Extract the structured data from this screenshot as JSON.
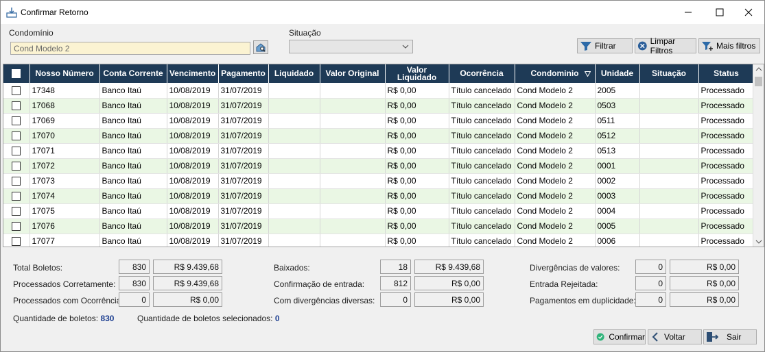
{
  "window": {
    "title": "Confirmar Retorno"
  },
  "filters": {
    "condominio_label": "Condomínio",
    "condominio_value": "Cond Modelo 2",
    "situacao_label": "Situação",
    "situacao_value": "",
    "filtrar_label": "Filtrar",
    "limpar_label": "Limpar Filtros",
    "mais_label": "Mais filtros"
  },
  "table": {
    "headers": [
      "Nosso Número",
      "Conta Corrente",
      "Vencimento",
      "Pagamento",
      "Liquidado",
      "Valor Original",
      "Valor Liquidado",
      "Ocorrência",
      "Condominio",
      "Unidade",
      "Situação",
      "Status"
    ],
    "rows": [
      {
        "nosso": "17348",
        "conta": "Banco Itaú",
        "venc": "10/08/2019",
        "pag": "31/07/2019",
        "liq": "",
        "orig": "",
        "vliq": "R$ 0,00",
        "oc": "Título cancelado",
        "cond": "Cond Modelo 2",
        "uni": "2005",
        "sit": "",
        "status": "Processado"
      },
      {
        "nosso": "17068",
        "conta": "Banco Itaú",
        "venc": "10/08/2019",
        "pag": "31/07/2019",
        "liq": "",
        "orig": "",
        "vliq": "R$ 0,00",
        "oc": "Título cancelado",
        "cond": "Cond Modelo 2",
        "uni": "0503",
        "sit": "",
        "status": "Processado"
      },
      {
        "nosso": "17069",
        "conta": "Banco Itaú",
        "venc": "10/08/2019",
        "pag": "31/07/2019",
        "liq": "",
        "orig": "",
        "vliq": "R$ 0,00",
        "oc": "Título cancelado",
        "cond": "Cond Modelo 2",
        "uni": "0511",
        "sit": "",
        "status": "Processado"
      },
      {
        "nosso": "17070",
        "conta": "Banco Itaú",
        "venc": "10/08/2019",
        "pag": "31/07/2019",
        "liq": "",
        "orig": "",
        "vliq": "R$ 0,00",
        "oc": "Título cancelado",
        "cond": "Cond Modelo 2",
        "uni": "0512",
        "sit": "",
        "status": "Processado"
      },
      {
        "nosso": "17071",
        "conta": "Banco Itaú",
        "venc": "10/08/2019",
        "pag": "31/07/2019",
        "liq": "",
        "orig": "",
        "vliq": "R$ 0,00",
        "oc": "Título cancelado",
        "cond": "Cond Modelo 2",
        "uni": "0513",
        "sit": "",
        "status": "Processado"
      },
      {
        "nosso": "17072",
        "conta": "Banco Itaú",
        "venc": "10/08/2019",
        "pag": "31/07/2019",
        "liq": "",
        "orig": "",
        "vliq": "R$ 0,00",
        "oc": "Título cancelado",
        "cond": "Cond Modelo 2",
        "uni": "0001",
        "sit": "",
        "status": "Processado"
      },
      {
        "nosso": "17073",
        "conta": "Banco Itaú",
        "venc": "10/08/2019",
        "pag": "31/07/2019",
        "liq": "",
        "orig": "",
        "vliq": "R$ 0,00",
        "oc": "Título cancelado",
        "cond": "Cond Modelo 2",
        "uni": "0002",
        "sit": "",
        "status": "Processado"
      },
      {
        "nosso": "17074",
        "conta": "Banco Itaú",
        "venc": "10/08/2019",
        "pag": "31/07/2019",
        "liq": "",
        "orig": "",
        "vliq": "R$ 0,00",
        "oc": "Título cancelado",
        "cond": "Cond Modelo 2",
        "uni": "0003",
        "sit": "",
        "status": "Processado"
      },
      {
        "nosso": "17075",
        "conta": "Banco Itaú",
        "venc": "10/08/2019",
        "pag": "31/07/2019",
        "liq": "",
        "orig": "",
        "vliq": "R$ 0,00",
        "oc": "Título cancelado",
        "cond": "Cond Modelo 2",
        "uni": "0004",
        "sit": "",
        "status": "Processado"
      },
      {
        "nosso": "17076",
        "conta": "Banco Itaú",
        "venc": "10/08/2019",
        "pag": "31/07/2019",
        "liq": "",
        "orig": "",
        "vliq": "R$ 0,00",
        "oc": "Título cancelado",
        "cond": "Cond Modelo 2",
        "uni": "0005",
        "sit": "",
        "status": "Processado"
      },
      {
        "nosso": "17077",
        "conta": "Banco Itaú",
        "venc": "10/08/2019",
        "pag": "31/07/2019",
        "liq": "",
        "orig": "",
        "vliq": "R$ 0,00",
        "oc": "Título cancelado",
        "cond": "Cond Modelo 2",
        "uni": "0006",
        "sit": "",
        "status": "Processado"
      }
    ]
  },
  "summary": {
    "total_boletos": {
      "label": "Total Boletos:",
      "count": "830",
      "value": "R$ 9.439,68"
    },
    "processados_ok": {
      "label": "Processados Corretamente:",
      "count": "830",
      "value": "R$ 9.439,68"
    },
    "processados_oc": {
      "label": "Processados com Ocorrências:",
      "count": "0",
      "value": "R$ 0,00"
    },
    "baixados": {
      "label": "Baixados:",
      "count": "18",
      "value": "R$ 9.439,68"
    },
    "confirmacao": {
      "label": "Confirmação de entrada:",
      "count": "812",
      "value": "R$ 0,00"
    },
    "divergencias_diversas": {
      "label": "Com divergências diversas:",
      "count": "0",
      "value": "R$ 0,00"
    },
    "divergencias_valores": {
      "label": "Divergências de valores:",
      "count": "0",
      "value": "R$ 0,00"
    },
    "entrada_rejeitada": {
      "label": "Entrada Rejeitada:",
      "count": "0",
      "value": "R$ 0,00"
    },
    "pag_duplicidade": {
      "label": "Pagamentos em duplicidade:",
      "count": "0",
      "value": "R$ 0,00"
    },
    "qtd_boletos_label": "Quantidade de boletos:",
    "qtd_boletos": "830",
    "qtd_selecionados_label": "Quantidade de boletos selecionados:",
    "qtd_selecionados": "0"
  },
  "buttons": {
    "confirmar": "Confirmar",
    "voltar": "Voltar",
    "sair": "Sair"
  },
  "colors": {
    "header_bg": "#1e3a56",
    "row_alt": "#eaf7e4",
    "count_text": "#1d3f91"
  }
}
